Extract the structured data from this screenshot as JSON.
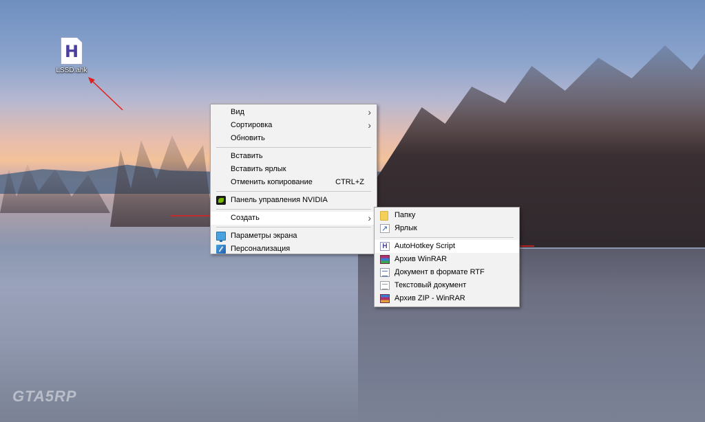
{
  "desktop": {
    "icon_label": "LSSD.ahk"
  },
  "context_menu": {
    "items": [
      {
        "label": "Вид",
        "has_submenu": true
      },
      {
        "label": "Сортировка",
        "has_submenu": true
      },
      {
        "label": "Обновить"
      },
      {
        "label": "Вставить"
      },
      {
        "label": "Вставить ярлык"
      },
      {
        "label": "Отменить копирование",
        "shortcut": "CTRL+Z"
      },
      {
        "label": "Панель управления NVIDIA",
        "icon": "nvidia-icon"
      },
      {
        "label": "Создать",
        "has_submenu": true,
        "highlighted": true
      },
      {
        "label": "Параметры экрана",
        "icon": "display-icon"
      },
      {
        "label": "Персонализация",
        "icon": "personalization-icon"
      }
    ]
  },
  "submenu": {
    "items": [
      {
        "label": "Папку",
        "icon": "folder-icon"
      },
      {
        "label": "Ярлык",
        "icon": "shortcut-icon"
      },
      {
        "label": "AutoHotkey Script",
        "icon": "autohotkey-icon",
        "highlighted": true
      },
      {
        "label": "Архив WinRAR",
        "icon": "winrar-icon"
      },
      {
        "label": "Документ в формате RTF",
        "icon": "rtf-document-icon"
      },
      {
        "label": "Текстовый документ",
        "icon": "text-document-icon"
      },
      {
        "label": "Архив ZIP - WinRAR",
        "icon": "zip-archive-icon"
      }
    ]
  },
  "watermark": "GTA5RP",
  "colors": {
    "menu_bg": "#f2f2f2",
    "highlight_bg": "#ffffff",
    "arrow": "#e02020"
  }
}
